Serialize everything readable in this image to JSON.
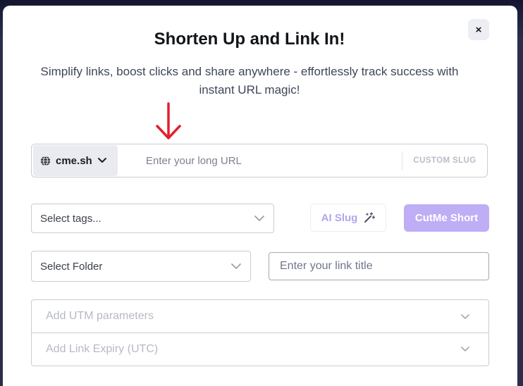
{
  "modal": {
    "close_label": "×",
    "title": "Shorten Up and Link In!",
    "subtitle": "Simplify links, boost clicks and share anywhere - effortlessly track success with instant URL magic!"
  },
  "url_bar": {
    "domain": "cme.sh",
    "url_placeholder": "Enter your long URL",
    "custom_slug_label": "CUSTOM SLUG"
  },
  "tags": {
    "placeholder": "Select tags..."
  },
  "ai_slug": {
    "label": "AI Slug"
  },
  "submit": {
    "label": "CutMe Short"
  },
  "folder": {
    "placeholder": "Select Folder"
  },
  "link_title": {
    "placeholder": "Enter your link title"
  },
  "options": [
    {
      "label": "Add UTM parameters"
    },
    {
      "label": "Add Link Expiry (UTC)"
    }
  ],
  "icons": {
    "arrow": "arrow-down-icon",
    "globe": "globe-icon",
    "chevron": "chevron-down-icon",
    "wand": "magic-wand-icon",
    "close": "close-icon"
  },
  "colors": {
    "accent": "#bfaef5",
    "accent_text": "#b3a6ea",
    "arrow": "#e0202e"
  }
}
